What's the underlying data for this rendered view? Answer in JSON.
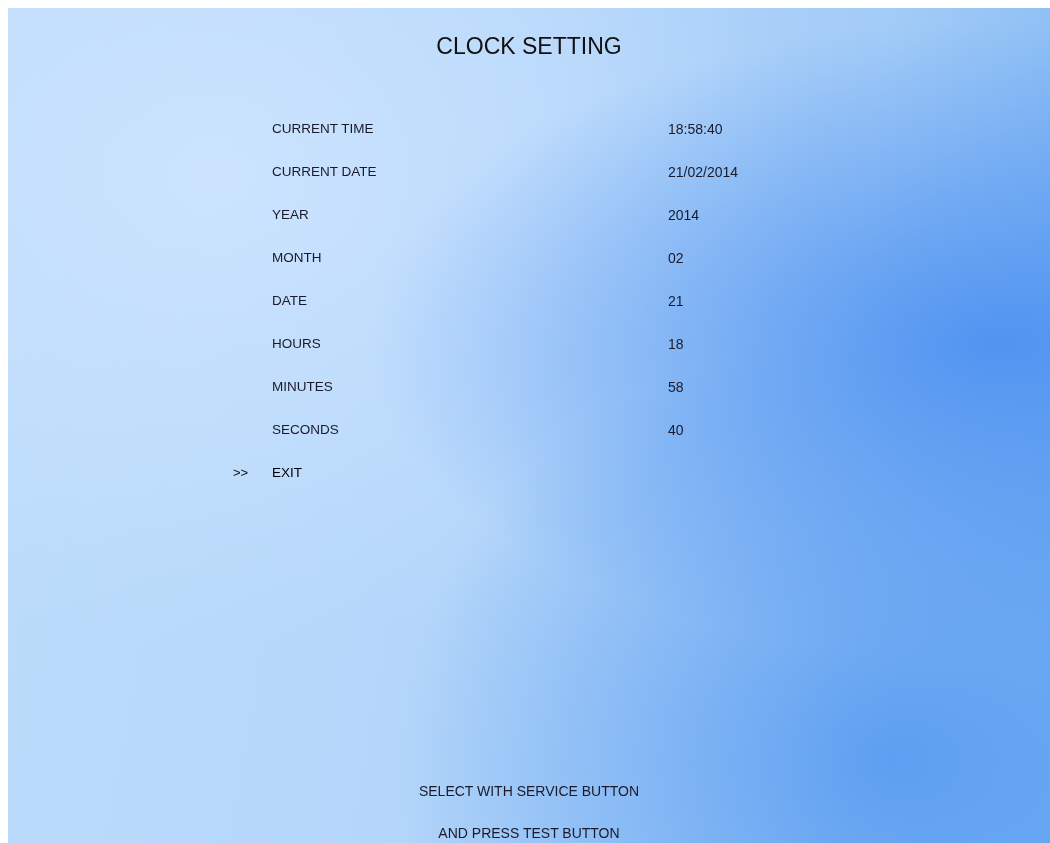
{
  "title": "CLOCK SETTING",
  "cursor": ">>",
  "items": [
    {
      "label": "CURRENT TIME",
      "value": "18:58:40",
      "selected": false
    },
    {
      "label": "CURRENT DATE",
      "value": "21/02/2014",
      "selected": false
    },
    {
      "label": "YEAR",
      "value": "2014",
      "selected": false
    },
    {
      "label": "MONTH",
      "value": "02",
      "selected": false
    },
    {
      "label": "DATE",
      "value": "21",
      "selected": false
    },
    {
      "label": "HOURS",
      "value": "18",
      "selected": false
    },
    {
      "label": "MINUTES",
      "value": "58",
      "selected": false
    },
    {
      "label": "SECONDS",
      "value": "40",
      "selected": false
    },
    {
      "label": "EXIT",
      "selected": true
    }
  ],
  "instructions": [
    "SELECT WITH SERVICE BUTTON",
    "AND PRESS TEST BUTTON"
  ]
}
